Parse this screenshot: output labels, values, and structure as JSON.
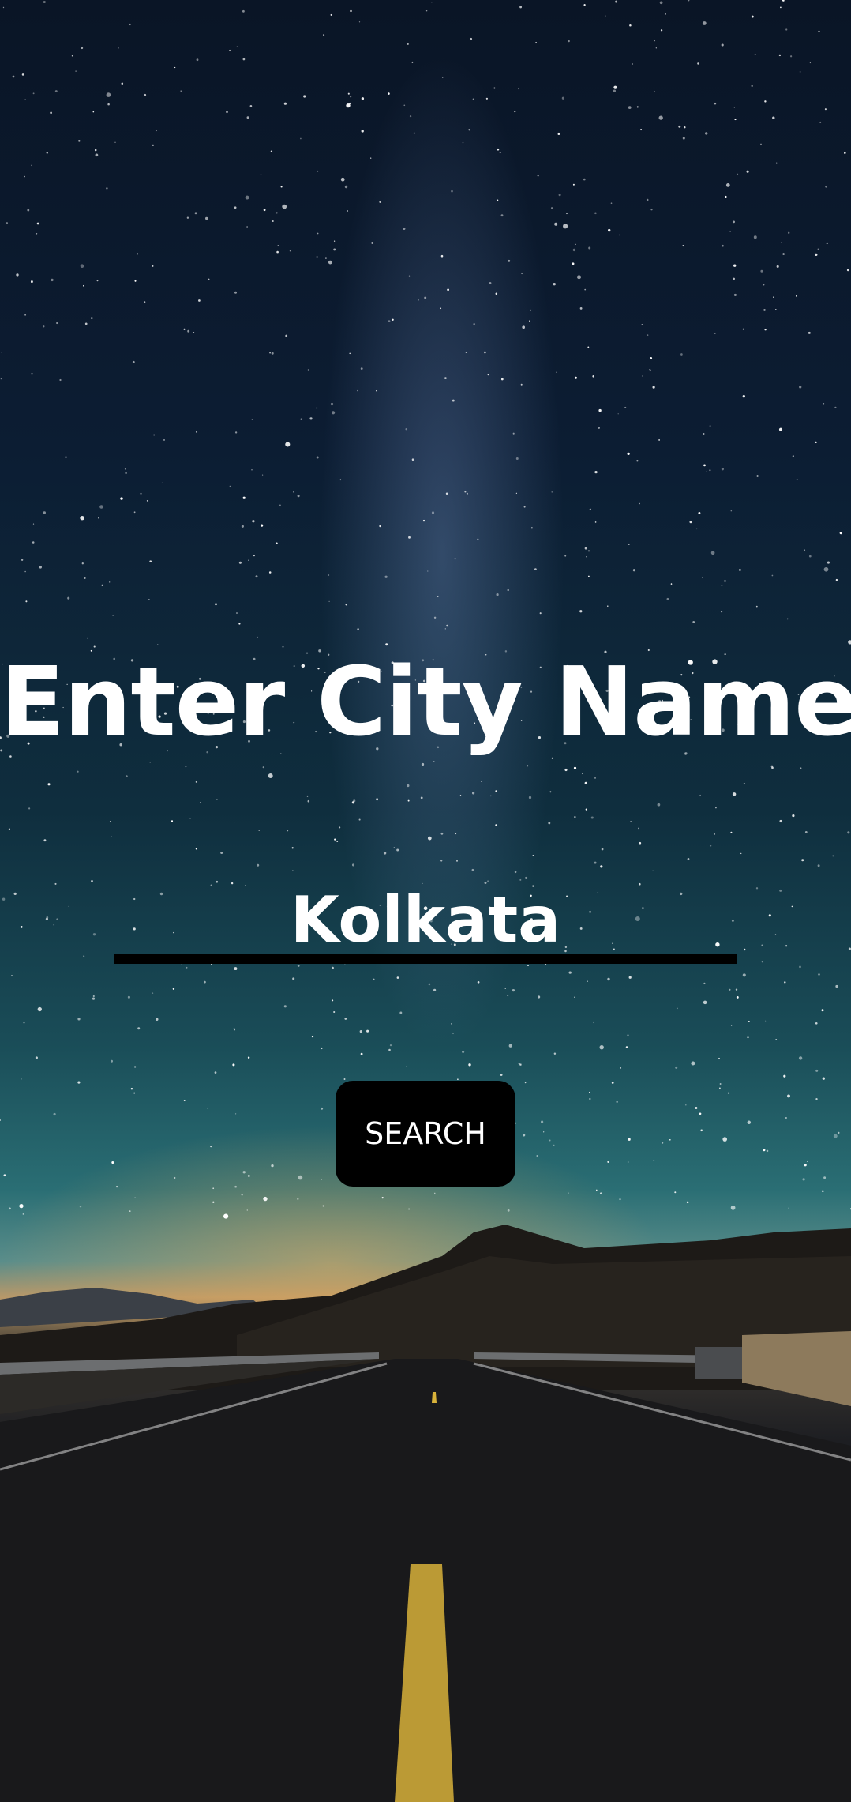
{
  "page": {
    "title": "Enter City Name"
  },
  "search": {
    "city_value": "Kolkata",
    "button_label": "SEARCH"
  },
  "colors": {
    "text": "#ffffff",
    "button_bg": "#000000",
    "underline": "#000000",
    "road_line": "#d8b23a"
  },
  "background": {
    "scene": "night-sky-milky-way-over-road-background"
  }
}
